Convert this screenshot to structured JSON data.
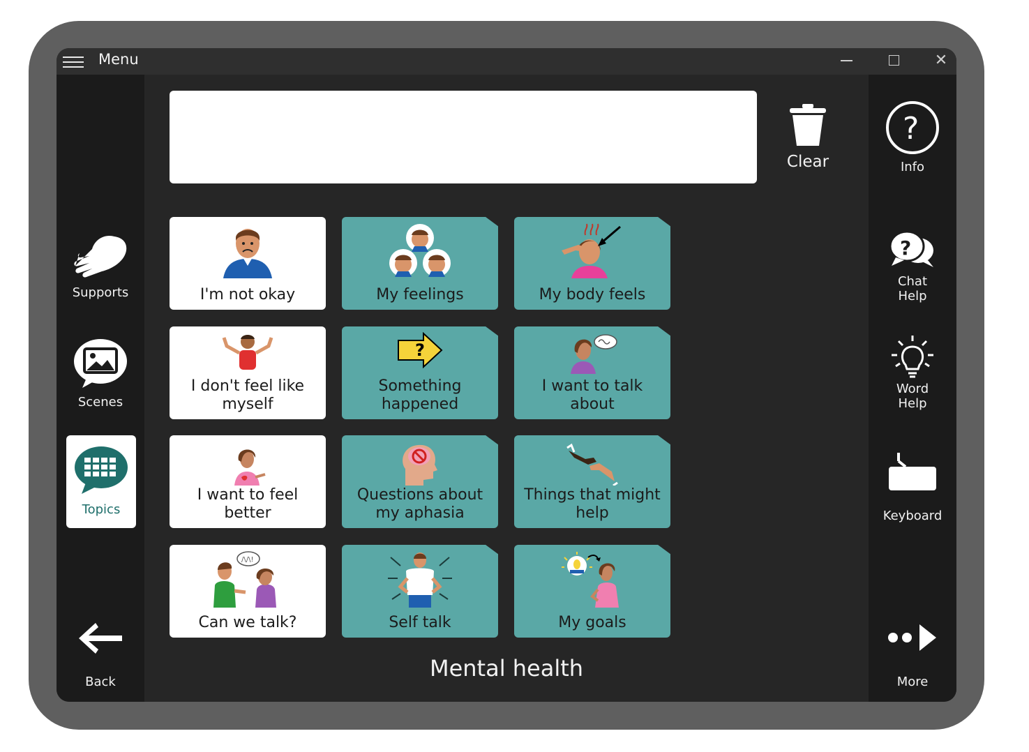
{
  "window": {
    "menu_label": "Menu"
  },
  "left_sidebar": {
    "supports": "Supports",
    "scenes": "Scenes",
    "topics": "Topics",
    "back": "Back"
  },
  "right_sidebar": {
    "info": "Info",
    "chat_help_1": "Chat",
    "chat_help_2": "Help",
    "word_help_1": "Word",
    "word_help_2": "Help",
    "keyboard": "Keyboard",
    "more": "More"
  },
  "toolbar": {
    "clear": "Clear"
  },
  "message": {
    "text": ""
  },
  "tiles": [
    {
      "label": "I'm not okay",
      "style": "white",
      "icon": "sad-man-icon"
    },
    {
      "label": "My feelings",
      "style": "teal",
      "icon": "faces-icon"
    },
    {
      "label": "My body feels",
      "style": "teal",
      "icon": "headache-icon"
    },
    {
      "label": "I don't feel like myself",
      "style": "white",
      "icon": "shrug-man-icon"
    },
    {
      "label": "Something happened",
      "style": "teal",
      "icon": "question-arrow-icon"
    },
    {
      "label": "I want to talk about",
      "style": "teal",
      "icon": "speaking-woman-icon"
    },
    {
      "label": "I want to feel better",
      "style": "white",
      "icon": "woman-heart-icon"
    },
    {
      "label": "Questions about my aphasia",
      "style": "teal",
      "icon": "brain-head-icon"
    },
    {
      "label": "Things that might help",
      "style": "teal",
      "icon": "helping-hands-icon"
    },
    {
      "label": "Can we talk?",
      "style": "white",
      "icon": "conversation-icon"
    },
    {
      "label": "Self talk",
      "style": "teal",
      "icon": "confident-man-icon"
    },
    {
      "label": "My goals",
      "style": "teal",
      "icon": "goal-woman-icon"
    }
  ],
  "board": {
    "title": "Mental health"
  },
  "colors": {
    "teal_tile": "#5aa8a6",
    "topics_active_text": "#1f6f6b",
    "dark_bg": "#262626",
    "side_bg": "#1b1b1b"
  }
}
